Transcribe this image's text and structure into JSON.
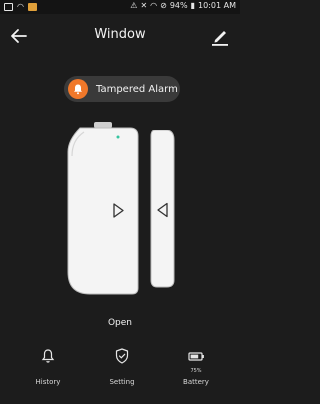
{
  "status_bar": {
    "battery_percent": "94%",
    "time": "10:01 AM"
  },
  "header": {
    "title": "Window"
  },
  "alarm": {
    "label": "Tampered Alarm",
    "color": "#f0782a"
  },
  "device": {
    "state": "Open"
  },
  "nav": {
    "history": "History",
    "setting": "Setting",
    "battery": "Battery",
    "battery_level": "75%"
  }
}
